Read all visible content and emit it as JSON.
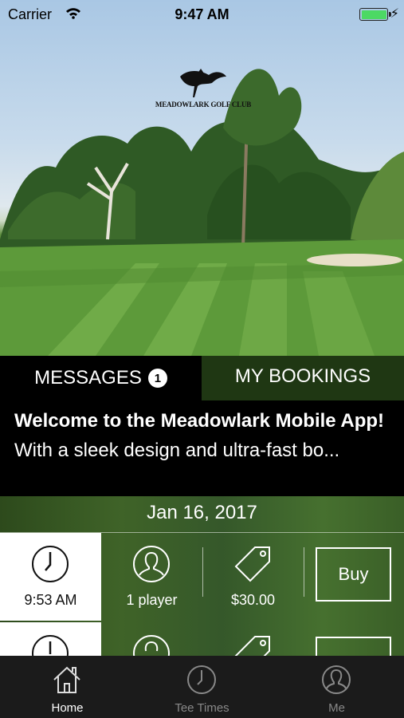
{
  "status_bar": {
    "carrier": "Carrier",
    "time": "9:47 AM",
    "battery_color": "#4cd964"
  },
  "hero": {
    "logo_text": "MEADOWLARK GOLF CLUB"
  },
  "tabs": {
    "messages_label": "MESSAGES",
    "messages_count": "1",
    "bookings_label": "MY BOOKINGS"
  },
  "message": {
    "title": "Welcome to the Meadowlark Mobile App!",
    "body": "With a sleek design and ultra-fast bo..."
  },
  "date": "Jan 16, 2017",
  "tee_times": [
    {
      "time": "9:53 AM",
      "players": "1 player",
      "price": "$30.00",
      "buy_label": "Buy"
    }
  ],
  "tabbar": {
    "items": [
      {
        "label": "Home",
        "icon": "home-icon",
        "active": true
      },
      {
        "label": "Tee Times",
        "icon": "clock-icon",
        "active": false
      },
      {
        "label": "Me",
        "icon": "user-icon",
        "active": false
      }
    ]
  }
}
